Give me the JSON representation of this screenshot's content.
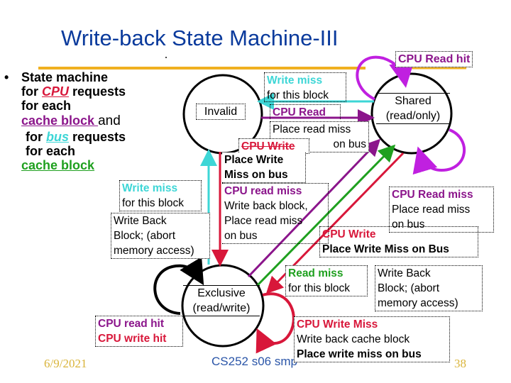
{
  "slide": {
    "title": "Write-back State Machine-III",
    "footer": {
      "date": "6/9/2021",
      "course": "CS252 s06 smp",
      "page": "38"
    }
  },
  "bullets": {
    "bullet_glyph": "•",
    "line1": "State machine",
    "line2_pre": "for ",
    "line2_cpu": "CPU",
    "line2_post": " requests",
    "line3": "for each",
    "line4_link": "cache block ",
    "line4_post": "and",
    "line5_pre": "for ",
    "line5_bus": "bus",
    "line5_post": " requests",
    "line6": "for each",
    "line7_link": "cache block"
  },
  "states": {
    "invalid": "Invalid",
    "shared": [
      "Shared",
      "(read/only)"
    ],
    "exclusive": [
      "Exclusive",
      "(read/write)"
    ]
  },
  "transitions": {
    "cpu_read_hit_shared": {
      "event": "CPU Read hit"
    },
    "shared_write_miss": {
      "event": "Write miss",
      "detail": "for this block"
    },
    "invalid_cpu_read": {
      "event": "CPU Read",
      "action": [
        "Place read miss",
        "on bus"
      ]
    },
    "invalid_cpu_write": {
      "event": "CPU Write",
      "action": [
        "Place Write",
        "Miss on bus"
      ]
    },
    "exclusive_cpu_read_miss": {
      "event": "CPU read miss",
      "action": [
        "Write back block,",
        "Place read miss",
        "on bus"
      ]
    },
    "exclusive_write_miss": {
      "event": "Write miss",
      "detail": "for this block"
    },
    "exclusive_write_back": {
      "action": [
        "Write Back",
        "Block; (abort",
        "memory access)"
      ]
    },
    "shared_cpu_read_miss": {
      "event": "CPU Read miss",
      "action": [
        "Place read miss",
        "on bus"
      ]
    },
    "shared_cpu_write": {
      "event": "CPU Write",
      "action": "Place Write Miss on Bus"
    },
    "exclusive_read_miss": {
      "event": "Read miss",
      "detail": "for this block"
    },
    "exclusive_read_miss_action": {
      "action": [
        "Write Back",
        "Block; (abort",
        "memory access)"
      ]
    },
    "exclusive_hits": {
      "event1": "CPU read hit",
      "event2": "CPU write hit"
    },
    "exclusive_cpu_write_miss": {
      "event": "CPU Write Miss",
      "action1": "Write back cache block",
      "action2": "Place write miss on bus"
    }
  },
  "colors": {
    "title": "#0a3a9c",
    "accent_rule": "#f0b020",
    "cpu_read": "#8b158b",
    "bus_write_miss": "#3dd6d6",
    "cpu_write": "#d8173a",
    "bus_read_miss": "#1fa01f",
    "read_hit_loop": "#c020e0"
  }
}
